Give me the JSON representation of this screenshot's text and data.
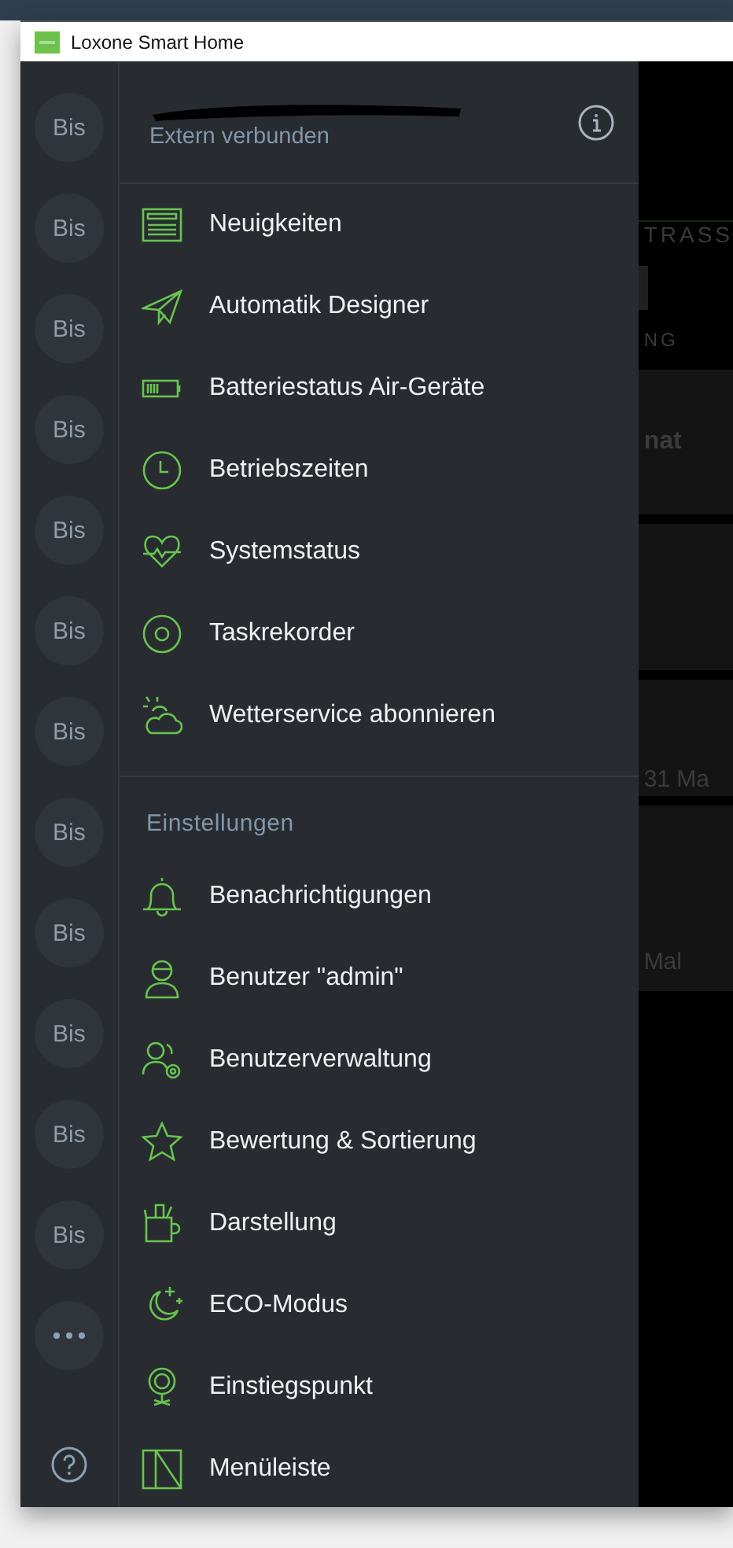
{
  "window": {
    "title": "Loxone Smart Home"
  },
  "rail": {
    "items": [
      {
        "label": "Bis"
      },
      {
        "label": "Bis"
      },
      {
        "label": "Bis"
      },
      {
        "label": "Bis"
      },
      {
        "label": "Bis"
      },
      {
        "label": "Bis"
      },
      {
        "label": "Bis"
      },
      {
        "label": "Bis"
      },
      {
        "label": "Bis"
      },
      {
        "label": "Bis"
      },
      {
        "label": "Bis"
      },
      {
        "label": "Bis"
      }
    ]
  },
  "header": {
    "subtitle": "Extern verbunden"
  },
  "menu": {
    "items": [
      {
        "label": "Neuigkeiten"
      },
      {
        "label": "Automatik Designer"
      },
      {
        "label": "Batteriestatus Air-Geräte"
      },
      {
        "label": "Betriebszeiten"
      },
      {
        "label": "Systemstatus"
      },
      {
        "label": "Taskrekorder"
      },
      {
        "label": "Wetterservice abonnieren"
      }
    ]
  },
  "settings": {
    "heading": "Einstellungen",
    "items": [
      {
        "label": "Benachrichtigungen"
      },
      {
        "label": "Benutzer \"admin\""
      },
      {
        "label": "Benutzerverwaltung"
      },
      {
        "label": "Bewertung & Sortierung"
      },
      {
        "label": "Darstellung"
      },
      {
        "label": "ECO-Modus"
      },
      {
        "label": "Einstiegspunkt"
      },
      {
        "label": "Menüleiste"
      }
    ]
  },
  "background": {
    "fragments": [
      "TRASS",
      "NG",
      "nat",
      "31 Ma",
      "Mal"
    ]
  }
}
